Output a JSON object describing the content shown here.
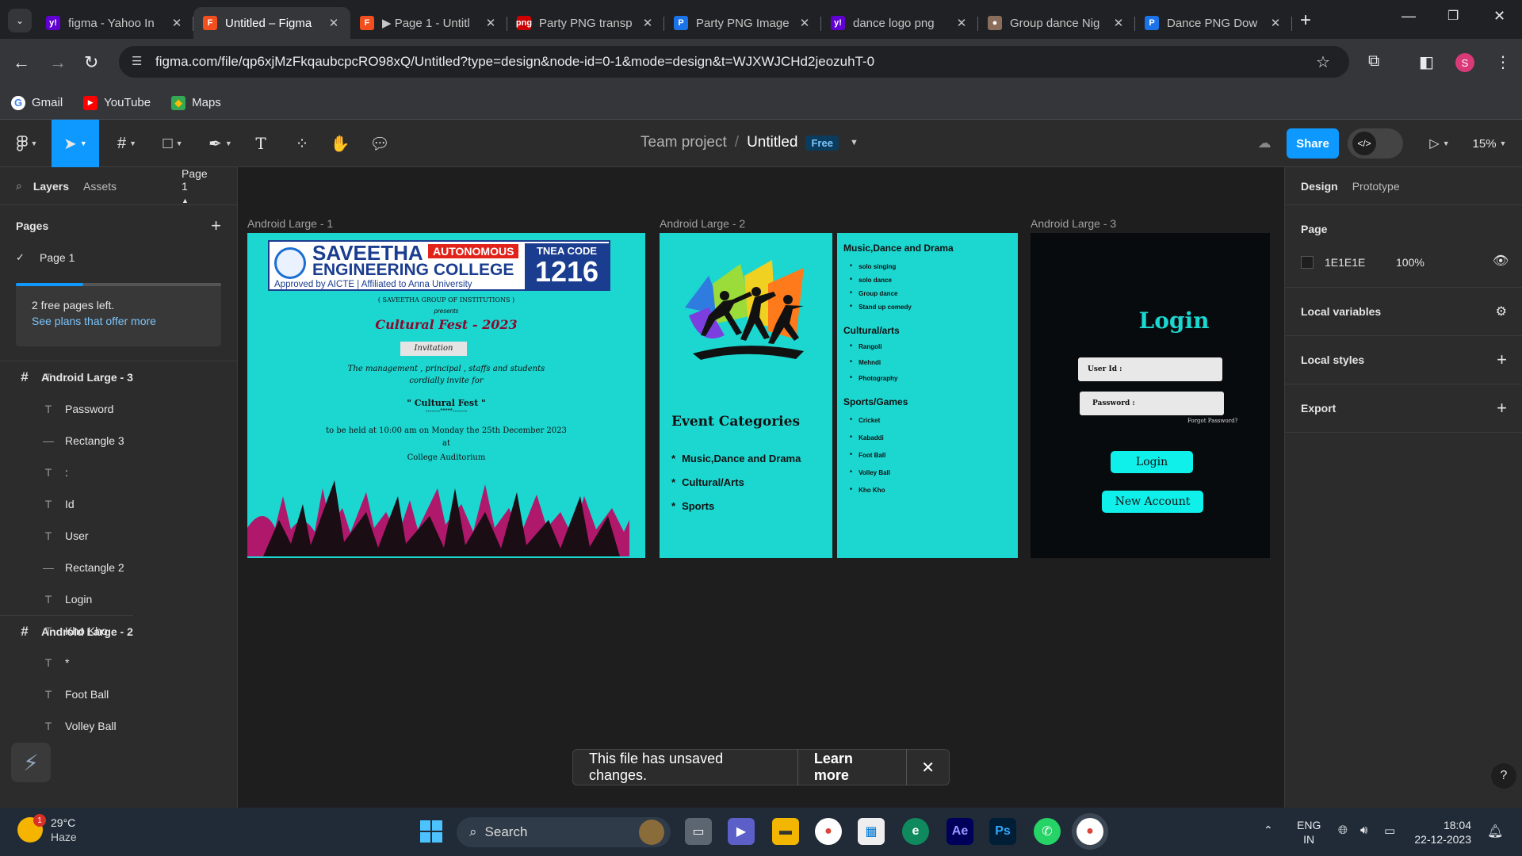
{
  "browser": {
    "tabs": [
      {
        "title": "figma - Yahoo In",
        "icon": "yahoo-icon",
        "color": "#6001d2",
        "glyph": "y!"
      },
      {
        "title": "Untitled – Figma",
        "icon": "figma-icon",
        "color": "#f24e1e",
        "glyph": "F",
        "active": true
      },
      {
        "title": "▶ Page 1 - Untitl",
        "icon": "figma-icon",
        "color": "#f24e1e",
        "glyph": "F"
      },
      {
        "title": "Party PNG transp",
        "icon": "pngtree-icon",
        "color": "#c00",
        "glyph": "png"
      },
      {
        "title": "Party PNG Image",
        "icon": "pngtree-p-icon",
        "color": "#1a73e8",
        "glyph": "P"
      },
      {
        "title": "dance logo png",
        "icon": "yahoo-icon",
        "color": "#6001d2",
        "glyph": "y!"
      },
      {
        "title": "Group dance Nig",
        "icon": "dancer-icon",
        "color": "#8a6d5a",
        "glyph": "●"
      },
      {
        "title": "Dance PNG Dow",
        "icon": "pngtree-p-icon",
        "color": "#1a73e8",
        "glyph": "P"
      }
    ],
    "url": "figma.com/file/qp6xjMzFkqaubcpcRO98xQ/Untitled?type=design&node-id=0-1&mode=design&t=WJXWJCHd2jeozuhT-0",
    "profile_initial": "S",
    "bookmarks": [
      {
        "label": "Gmail",
        "icon": "google-icon"
      },
      {
        "label": "YouTube",
        "icon": "youtube-icon"
      },
      {
        "label": "Maps",
        "icon": "maps-icon"
      }
    ]
  },
  "figma": {
    "team": "Team project",
    "file_name": "Untitled",
    "plan_badge": "Free",
    "share_label": "Share",
    "zoom": "15%",
    "left": {
      "tab_layers": "Layers",
      "tab_assets": "Assets",
      "page_switch": "Page 1",
      "pages_heading": "Pages",
      "current_page": "Page 1",
      "free_pages_text": "2 free pages left.",
      "plans_link": "See plans that offer more",
      "free_pages_used_fraction": 0.33,
      "layers": [
        {
          "kind": "frame",
          "label": "Android Large - 3"
        },
        {
          "kind": "text",
          "label": ":"
        },
        {
          "kind": "text",
          "label": "Password"
        },
        {
          "kind": "rect",
          "label": "Rectangle 3"
        },
        {
          "kind": "text",
          "label": ":"
        },
        {
          "kind": "text",
          "label": "Id"
        },
        {
          "kind": "text",
          "label": "User"
        },
        {
          "kind": "rect",
          "label": "Rectangle 2"
        },
        {
          "kind": "text",
          "label": "Login"
        },
        {
          "kind": "frame",
          "label": "Android Large - 2"
        },
        {
          "kind": "text",
          "label": "Kho Kho"
        },
        {
          "kind": "text",
          "label": "*"
        },
        {
          "kind": "text",
          "label": "Foot Ball"
        },
        {
          "kind": "text",
          "label": "Volley Ball"
        }
      ]
    },
    "right": {
      "tab_design": "Design",
      "tab_prototype": "Prototype",
      "page_heading": "Page",
      "bg_hex": "1E1E1E",
      "bg_opacity": "100%",
      "local_variables": "Local variables",
      "local_styles": "Local styles",
      "export": "Export"
    },
    "toast": {
      "message": "This file has unsaved changes.",
      "action": "Learn more"
    }
  },
  "frames": {
    "f1": {
      "label": "Android Large - 1",
      "college_name": "SAVEETHA",
      "college_line2": "ENGINEERING COLLEGE",
      "autonomous": "AUTONOMOUS",
      "tnea_label": "TNEA CODE",
      "tnea_code": "1216",
      "approved": "Approved by AICTE | Affiliated to Anna University",
      "group": "( SAVEETHA GROUP OF INSTITUTIONS )",
      "presents": "presents",
      "fest_title": "Cultural Fest - 2023",
      "invitation": "Invitation",
      "line1": "The management , principal , staffs and students",
      "line2": "cordially invite for",
      "quote": "\" Cultural Fest \"",
      "stars": "-------*****-------",
      "date_line": "to be held at 10:00 am on Monday the 25th December 2023",
      "at": "at",
      "venue": "College Auditorium"
    },
    "f2": {
      "label": "Android Large - 2",
      "event_heading": "Event Categories",
      "event_items": [
        "Music,Dance and Drama",
        "Cultural/Arts",
        "Sports"
      ],
      "right_heading1": "Music,Dance and Drama",
      "music_items": [
        "solo singing",
        "solo dance",
        "Group dance",
        "Stand up comedy"
      ],
      "right_heading2": "Cultural/arts",
      "arts_items": [
        "Rangoli",
        "Mehndi",
        "Photography"
      ],
      "right_heading3": "Sports/Games",
      "sports_items": [
        "Cricket",
        "Kabaddi",
        "Foot Ball",
        "Volley Ball",
        "Kho Kho"
      ]
    },
    "f3": {
      "label": "Android Large - 3",
      "title": "Login",
      "user_label": "User Id :",
      "password_label": "Password :",
      "forgot": "Forgot Password?",
      "login_button": "Login",
      "new_account": "New Account"
    }
  },
  "taskbar": {
    "weather_temp": "29°C",
    "weather_desc": "Haze",
    "weather_badge": "1",
    "search_placeholder": "Search",
    "lang1": "ENG",
    "lang2": "IN",
    "time": "18:04",
    "date": "22-12-2023"
  },
  "colors": {
    "accent": "#0d99ff",
    "teal": "#1cd6d0",
    "figma_panel": "#2c2c2c",
    "canvas": "#1e1e1e"
  }
}
